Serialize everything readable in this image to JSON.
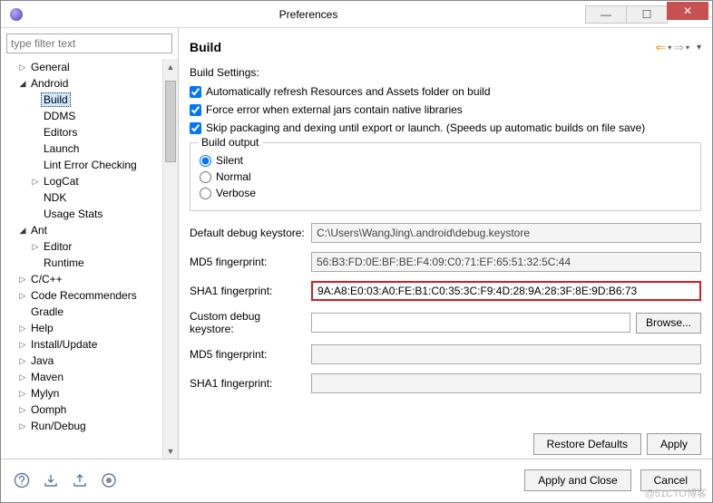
{
  "window": {
    "title": "Preferences"
  },
  "filter": {
    "placeholder": "type filter text"
  },
  "tree": [
    {
      "label": "General",
      "level": 1,
      "arrow": "▷"
    },
    {
      "label": "Android",
      "level": 1,
      "arrow": "▲",
      "expanded": true
    },
    {
      "label": "Build",
      "level": 2,
      "arrow": "",
      "selected": true
    },
    {
      "label": "DDMS",
      "level": 2,
      "arrow": ""
    },
    {
      "label": "Editors",
      "level": 2,
      "arrow": ""
    },
    {
      "label": "Launch",
      "level": 2,
      "arrow": ""
    },
    {
      "label": "Lint Error Checking",
      "level": 2,
      "arrow": ""
    },
    {
      "label": "LogCat",
      "level": 2,
      "arrow": "▷"
    },
    {
      "label": "NDK",
      "level": 2,
      "arrow": ""
    },
    {
      "label": "Usage Stats",
      "level": 2,
      "arrow": ""
    },
    {
      "label": "Ant",
      "level": 1,
      "arrow": "▲",
      "expanded": true
    },
    {
      "label": "Editor",
      "level": 2,
      "arrow": "▷"
    },
    {
      "label": "Runtime",
      "level": 2,
      "arrow": ""
    },
    {
      "label": "C/C++",
      "level": 1,
      "arrow": "▷"
    },
    {
      "label": "Code Recommenders",
      "level": 1,
      "arrow": "▷"
    },
    {
      "label": "Gradle",
      "level": 1,
      "arrow": ""
    },
    {
      "label": "Help",
      "level": 1,
      "arrow": "▷"
    },
    {
      "label": "Install/Update",
      "level": 1,
      "arrow": "▷"
    },
    {
      "label": "Java",
      "level": 1,
      "arrow": "▷"
    },
    {
      "label": "Maven",
      "level": 1,
      "arrow": "▷"
    },
    {
      "label": "Mylyn",
      "level": 1,
      "arrow": "▷"
    },
    {
      "label": "Oomph",
      "level": 1,
      "arrow": "▷"
    },
    {
      "label": "Run/Debug",
      "level": 1,
      "arrow": "▷"
    }
  ],
  "page": {
    "heading": "Build",
    "settings_label": "Build Settings:",
    "checks": {
      "auto_refresh": "Automatically refresh Resources and Assets folder on build",
      "force_error": "Force error when external jars contain native libraries",
      "skip_pack": "Skip packaging and dexing until export or launch. (Speeds up automatic builds on file save)"
    },
    "build_output": {
      "legend": "Build output",
      "silent": "Silent",
      "normal": "Normal",
      "verbose": "Verbose"
    },
    "fields": {
      "default_keystore_label": "Default debug keystore:",
      "default_keystore_value": "C:\\Users\\WangJing\\.android\\debug.keystore",
      "md5_label": "MD5 fingerprint:",
      "md5_value": "56:B3:FD:0E:BF:BE:F4:09:C0:71:EF:65:51:32:5C:44",
      "sha1_label": "SHA1 fingerprint:",
      "sha1_value": "9A:A8:E0:03:A0:FE:B1:C0:35:3C:F9:4D:28:9A:28:3F:8E:9D:B6:73",
      "custom_keystore_label": "Custom debug keystore:",
      "custom_keystore_value": "",
      "md5_c_label": "MD5 fingerprint:",
      "md5_c_value": "",
      "sha1_c_label": "SHA1 fingerprint:",
      "sha1_c_value": "",
      "browse": "Browse..."
    },
    "buttons": {
      "restore": "Restore Defaults",
      "apply": "Apply"
    }
  },
  "footer": {
    "apply_close": "Apply and Close",
    "cancel": "Cancel"
  },
  "watermark": "@51CTO博客"
}
